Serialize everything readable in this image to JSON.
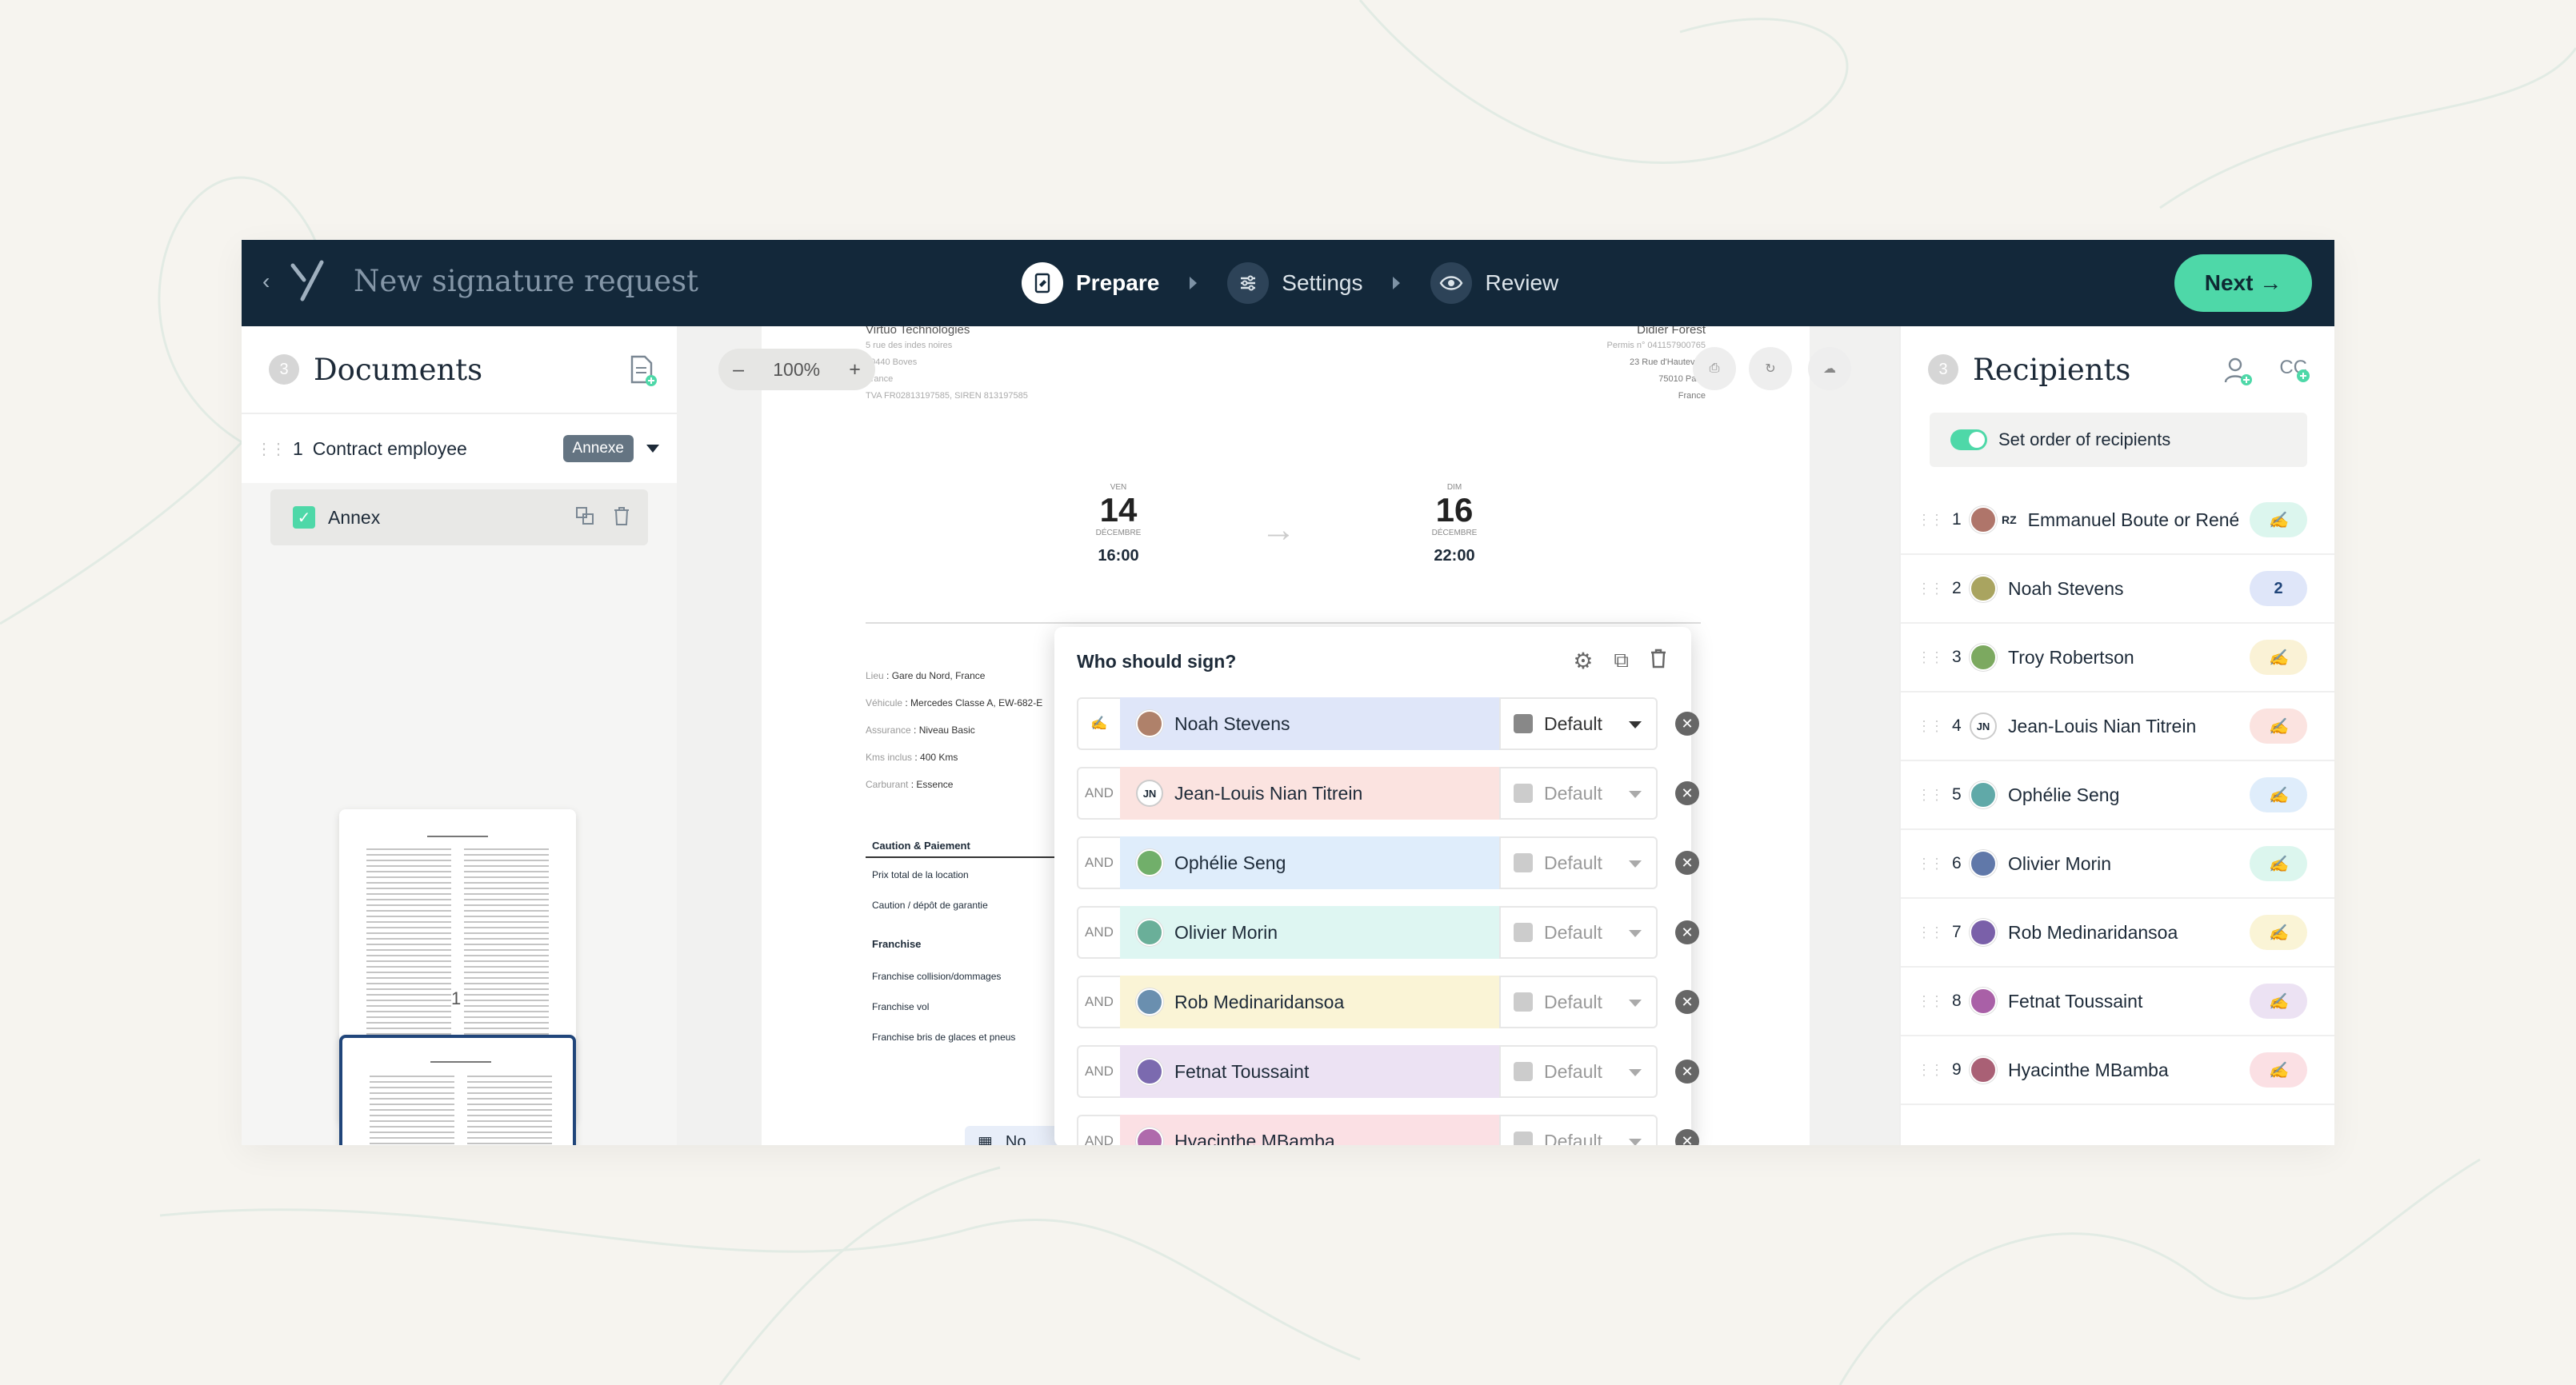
{
  "header": {
    "title": "New signature request",
    "steps": [
      {
        "label": "Prepare",
        "icon": "document-sign-icon",
        "active": true
      },
      {
        "label": "Settings",
        "icon": "sliders-icon",
        "active": false
      },
      {
        "label": "Review",
        "icon": "eye-icon",
        "active": false
      }
    ],
    "next_label": "Next →"
  },
  "documents": {
    "count": "3",
    "title": "Documents",
    "items": [
      {
        "num": "1",
        "name": "Contract employee",
        "badge": "Annexe"
      }
    ],
    "annex": {
      "label": "Annex",
      "checked": true
    },
    "page_numbers": [
      "1"
    ]
  },
  "viewer": {
    "zoom": "100%",
    "company": "Virtuo Technologies",
    "company_lines": [
      "5 rue des indes noires",
      "10440 Boves",
      "France",
      "TVA FR02813197585, SIREN 813197585"
    ],
    "client": "Didier Forest",
    "client_lines": [
      "Permis n° 041157900765",
      "23 Rue d'Hauteville",
      "75010 Paris",
      "France"
    ],
    "start": {
      "dow": "VEN",
      "day": "14",
      "month": "DÉCEMBRE",
      "time": "16:00"
    },
    "end": {
      "dow": "DIM",
      "day": "16",
      "month": "DÉCEMBRE",
      "time": "22:00"
    },
    "details": [
      {
        "k": "Lieu",
        "v": "Gare du Nord, France"
      },
      {
        "k": "Véhicule",
        "v": "Mercedes Classe A, EW-682-E"
      },
      {
        "k": "Assurance",
        "v": "Niveau Basic"
      },
      {
        "k": "Kms inclus",
        "v": "400 Kms"
      },
      {
        "k": "Carburant",
        "v": "Essence"
      }
    ],
    "section1": "Caution & Paiement",
    "section1_items": [
      "Prix total de la location",
      "Caution / dépôt de garantie"
    ],
    "section2": "Franchise",
    "section2_items": [
      "Franchise collision/dommages",
      "Franchise vol",
      "Franchise bris de glaces et pneus"
    ],
    "footer_stub": "No"
  },
  "modal": {
    "title": "Who should sign?",
    "signers": [
      {
        "prefix": "",
        "name": "Noah Stevens",
        "role": "Default",
        "color": "#dfe6f9"
      },
      {
        "prefix": "AND",
        "name": "Jean-Louis Nian Titrein",
        "role": "Default",
        "color": "#fbe3e0",
        "initials": "JN"
      },
      {
        "prefix": "AND",
        "name": "Ophélie Seng",
        "role": "Default",
        "color": "#dfedfb"
      },
      {
        "prefix": "AND",
        "name": "Olivier Morin",
        "role": "Default",
        "color": "#def6f2"
      },
      {
        "prefix": "AND",
        "name": "Rob Medinaridansoa",
        "role": "Default",
        "color": "#faf4d6"
      },
      {
        "prefix": "AND",
        "name": "Fetnat Toussaint",
        "role": "Default",
        "color": "#ece2f3"
      },
      {
        "prefix": "AND",
        "name": "Hyacinthe MBamba",
        "role": "Default",
        "color": "#fbe0e4"
      }
    ]
  },
  "recipients": {
    "count": "3",
    "title": "Recipients",
    "cc_label": "CC",
    "order_label": "Set order of recipients",
    "list": [
      {
        "num": "1",
        "name": "Emmanuel Boute or René",
        "initials": "RZ",
        "pill": "#dcf6ee",
        "pill_text": ""
      },
      {
        "num": "2",
        "name": "Noah Stevens",
        "pill": "#dfe6f9",
        "pill_text": "2"
      },
      {
        "num": "3",
        "name": "Troy Robertson",
        "pill": "#faf2d6",
        "pill_text": ""
      },
      {
        "num": "4",
        "name": "Jean-Louis Nian Titrein",
        "initials": "JN",
        "pill": "#fbe3e0",
        "pill_text": ""
      },
      {
        "num": "5",
        "name": "Ophélie Seng",
        "pill": "#dfedfb",
        "pill_text": ""
      },
      {
        "num": "6",
        "name": "Olivier Morin",
        "pill": "#dcf6ee",
        "pill_text": ""
      },
      {
        "num": "7",
        "name": "Rob Medinaridansoa",
        "pill": "#faf4d6",
        "pill_text": ""
      },
      {
        "num": "8",
        "name": "Fetnat Toussaint",
        "pill": "#ece2f3",
        "pill_text": ""
      },
      {
        "num": "9",
        "name": "Hyacinthe MBamba",
        "pill": "#fbe0e4",
        "pill_text": ""
      }
    ]
  },
  "colors": {
    "navy": "#13283a",
    "accent": "#4ed8a8"
  }
}
